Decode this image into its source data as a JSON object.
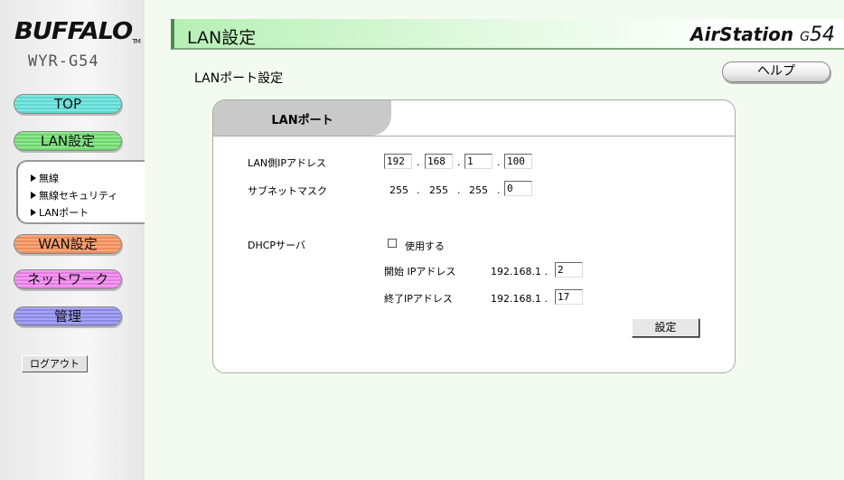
{
  "brand": {
    "logo": "BUFFALO",
    "model": "WYR-G54",
    "product_main": "AirStation",
    "product_suffix_small": "G",
    "product_suffix": "54"
  },
  "nav": {
    "top": "TOP",
    "lan": "LAN設定",
    "submenu": [
      "無線",
      "無線セキュリティ",
      "LANポート"
    ],
    "wan": "WAN設定",
    "network": "ネットワーク",
    "management": "管理",
    "logout": "ログアウト"
  },
  "header": {
    "title": "LAN設定"
  },
  "page": {
    "section_title": "LANポート設定",
    "help_label": "ヘルプ"
  },
  "panel": {
    "tab_label": "LANポート",
    "lan_ip_label": "LAN側IPアドレス",
    "lan_ip": [
      "192",
      "168",
      "1",
      "100"
    ],
    "subnet_label": "サブネットマスク",
    "subnet_fixed": [
      "255",
      "255",
      "255"
    ],
    "subnet_last": "0",
    "dhcp_label": "DHCPサーバ",
    "dhcp_use_label": "使用する",
    "dhcp_use_checked": false,
    "start_ip_label": "開始 IPアドレス",
    "start_ip_prefix": "192.168.1 .",
    "start_ip_last": "2",
    "end_ip_label": "終了IPアドレス",
    "end_ip_prefix": "192.168.1 .",
    "end_ip_last": "17",
    "set_label": "設定"
  },
  "colors": {
    "nav_top": "#5fd6d0",
    "nav_lan": "#6cd46c",
    "nav_wan": "#ec8c5c",
    "nav_network": "#e27de0",
    "nav_management": "#8886e2",
    "header_green": "#b6f0b4"
  }
}
